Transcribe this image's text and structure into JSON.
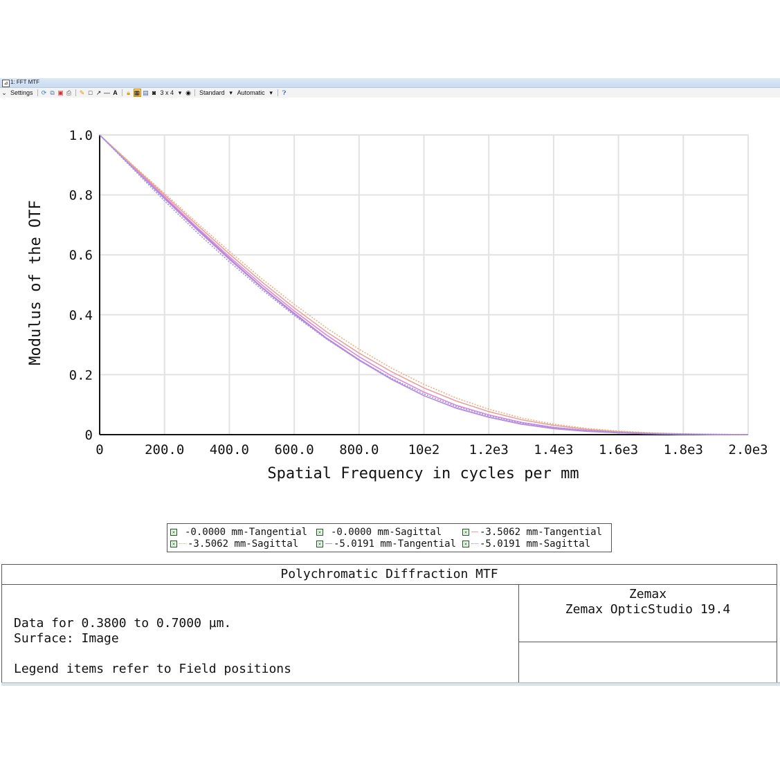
{
  "window": {
    "title": "1: FFT MTF",
    "icon": "window-icon"
  },
  "toolbar": {
    "settings_label": "Settings",
    "grid_label": "3 x 4",
    "standard_label": "Standard",
    "automatic_label": "Automatic",
    "icons": [
      "refresh-icon",
      "copy-icon",
      "save-icon",
      "print-icon",
      "pencil-icon",
      "rectangle-icon",
      "arrow-icon",
      "line-icon",
      "text-icon",
      "lock-icon",
      "grid-icon",
      "window-icon",
      "layers-icon",
      "help-icon"
    ]
  },
  "chart_data": {
    "type": "line",
    "xlabel": "Spatial Frequency in cycles per mm",
    "ylabel": "Modulus of the OTF",
    "xlim": [
      0,
      2000
    ],
    "ylim": [
      0,
      1.0
    ],
    "x_tick_values": [
      0,
      200,
      400,
      600,
      800,
      1000,
      1200,
      1400,
      1600,
      1800,
      2000
    ],
    "x_tick_labels": [
      "0",
      "200.0",
      "400.0",
      "600.0",
      "800.0",
      "10e2",
      "1.2e3",
      "1.4e3",
      "1.6e3",
      "1.8e3",
      "2.0e3"
    ],
    "y_tick_values": [
      0,
      0.2,
      0.4,
      0.6,
      0.8,
      1.0
    ],
    "y_tick_labels": [
      "0",
      "0.2",
      "0.4",
      "0.6",
      "0.8",
      "1.0"
    ],
    "grid": true,
    "x": [
      0,
      100,
      200,
      300,
      400,
      500,
      600,
      700,
      800,
      900,
      1000,
      1100,
      1200,
      1300,
      1400,
      1500,
      1600,
      1700,
      1800,
      1900,
      2000
    ],
    "series": [
      {
        "name": "-0.0000 mm-Tangential",
        "color": "#c86bd6",
        "dash": "solid",
        "values": [
          1.0,
          0.895,
          0.79,
          0.687,
          0.588,
          0.492,
          0.405,
          0.322,
          0.25,
          0.185,
          0.13,
          0.088,
          0.058,
          0.035,
          0.02,
          0.011,
          0.006,
          0.003,
          0.001,
          0.0,
          0.0
        ]
      },
      {
        "name": "-0.0000 mm-Sagittal",
        "color": "#d98ad6",
        "dash": "solid",
        "values": [
          1.0,
          0.897,
          0.794,
          0.692,
          0.594,
          0.5,
          0.413,
          0.332,
          0.26,
          0.196,
          0.142,
          0.098,
          0.066,
          0.041,
          0.024,
          0.014,
          0.008,
          0.004,
          0.002,
          0.0,
          0.0
        ]
      },
      {
        "name": "-3.5062 mm-Tangential",
        "color": "#e8a0a0",
        "dash": "solid",
        "values": [
          1.0,
          0.9,
          0.8,
          0.7,
          0.603,
          0.51,
          0.423,
          0.343,
          0.272,
          0.21,
          0.156,
          0.112,
          0.077,
          0.05,
          0.031,
          0.018,
          0.01,
          0.005,
          0.002,
          0.001,
          0.0
        ]
      },
      {
        "name": "-3.5062 mm-Sagittal",
        "color": "#eab07a",
        "dash": "dotted",
        "values": [
          1.0,
          0.902,
          0.805,
          0.707,
          0.612,
          0.52,
          0.435,
          0.356,
          0.285,
          0.222,
          0.168,
          0.122,
          0.085,
          0.056,
          0.035,
          0.021,
          0.012,
          0.006,
          0.003,
          0.001,
          0.0
        ]
      },
      {
        "name": "-5.0191 mm-Tangential",
        "color": "#b095e0",
        "dash": "solid",
        "values": [
          1.0,
          0.893,
          0.787,
          0.684,
          0.585,
          0.49,
          0.402,
          0.32,
          0.248,
          0.184,
          0.13,
          0.089,
          0.059,
          0.036,
          0.021,
          0.012,
          0.006,
          0.003,
          0.001,
          0.0,
          0.0
        ]
      },
      {
        "name": "-5.0191 mm-Sagittal",
        "color": "#a58be0",
        "dash": "dotted",
        "values": [
          1.0,
          0.89,
          0.78,
          0.675,
          0.577,
          0.484,
          0.398,
          0.319,
          0.249,
          0.188,
          0.136,
          0.094,
          0.063,
          0.04,
          0.024,
          0.014,
          0.008,
          0.004,
          0.002,
          0.001,
          0.0
        ]
      }
    ]
  },
  "legend": {
    "items": [
      "-0.0000 mm-Tangential",
      "-0.0000 mm-Sagittal",
      "-3.5062 mm-Tangential",
      "-3.5062 mm-Sagittal",
      "-5.0191 mm-Tangential",
      "-5.0191 mm-Sagittal"
    ]
  },
  "info": {
    "title": "Polychromatic Diffraction MTF",
    "data_line": "Data for 0.3800 to 0.7000 µm.",
    "surface_line": "Surface: Image",
    "legend_note": "Legend items refer to Field positions",
    "company": "Zemax",
    "product": "Zemax OpticStudio 19.4"
  }
}
